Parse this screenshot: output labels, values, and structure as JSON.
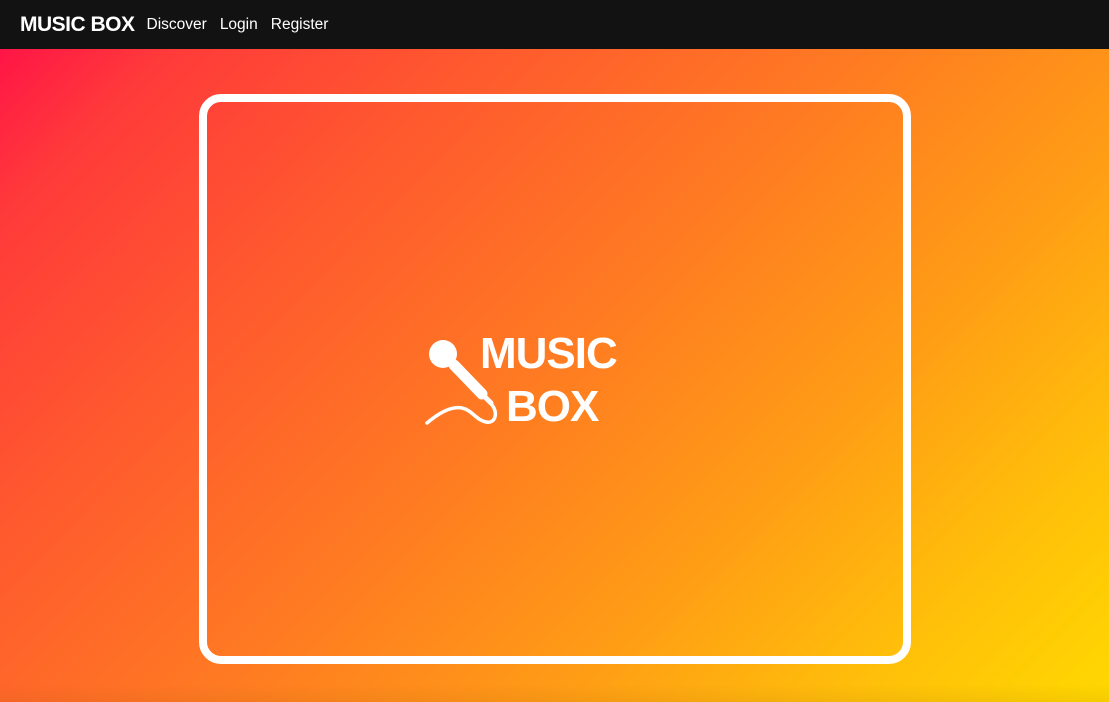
{
  "navbar": {
    "brand": "MUSIC BOX",
    "links": [
      {
        "label": "Discover"
      },
      {
        "label": "Login"
      },
      {
        "label": "Register"
      }
    ]
  },
  "hero": {
    "logo_line1": "MUSIC",
    "logo_line2": "BOX",
    "logo_icon": "microphone-icon"
  },
  "colors": {
    "navbar_bg": "#121212",
    "gradient_start": "#ff0a4a",
    "gradient_end": "#ffd800",
    "frame_border": "#ffffff"
  }
}
